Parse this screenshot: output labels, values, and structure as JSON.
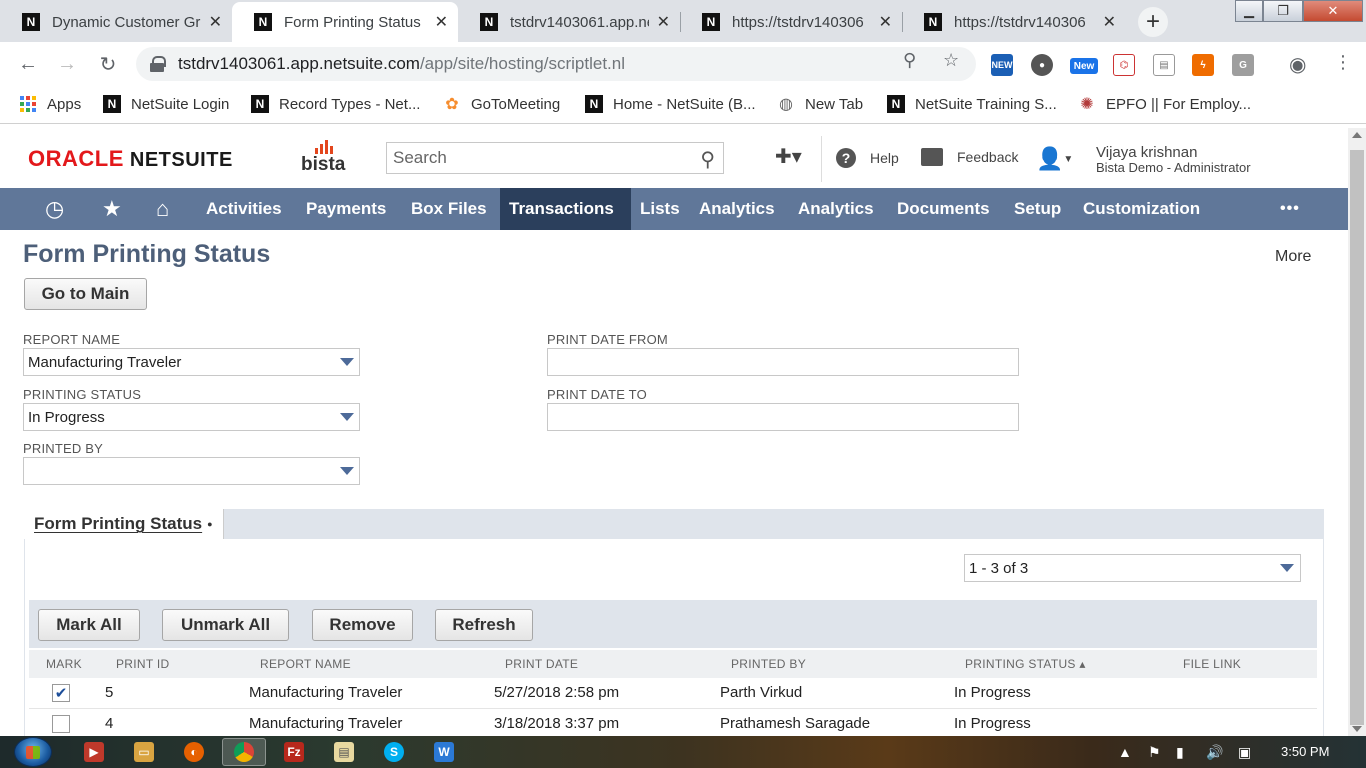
{
  "browser": {
    "tabs": [
      {
        "label": "Dynamic Customer Gr",
        "active": false
      },
      {
        "label": "Form Printing Status",
        "active": true
      },
      {
        "label": "tstdrv1403061.app.ne",
        "active": false
      },
      {
        "label": "https://tstdrv140306",
        "active": false
      },
      {
        "label": "https://tstdrv140306",
        "active": false
      }
    ],
    "url_host": "tstdrv1403061.app.netsuite.com",
    "url_path": "/app/site/hosting/scriptlet.nl",
    "bookmarks": [
      {
        "label": "Apps",
        "icon": "apps-grid-icon"
      },
      {
        "label": "NetSuite Login",
        "icon": "netsuite-icon"
      },
      {
        "label": "Record Types - Net...",
        "icon": "netsuite-icon"
      },
      {
        "label": "GoToMeeting",
        "icon": "gotomeeting-icon"
      },
      {
        "label": "Home - NetSuite (B...",
        "icon": "netsuite-icon"
      },
      {
        "label": "New Tab",
        "icon": "globe-icon"
      },
      {
        "label": "NetSuite Training S...",
        "icon": "netsuite-icon"
      },
      {
        "label": "EPFO || For Employ...",
        "icon": "epfo-icon"
      }
    ],
    "extension_badge_new": "New",
    "extension_new_label": "NEW"
  },
  "netsuite": {
    "logo_oracle": "ORACLE",
    "logo_netsuite": "NETSUITE",
    "logo_bista": "bista",
    "search_placeholder": "Search",
    "help_label": "Help",
    "feedback_label": "Feedback",
    "user_name": "Vijaya krishnan",
    "user_role": "Bista Demo - Administrator",
    "nav_items": [
      {
        "label": "Activities",
        "active": false
      },
      {
        "label": "Payments",
        "active": false
      },
      {
        "label": "Box Files",
        "active": false
      },
      {
        "label": "Transactions",
        "active": true
      },
      {
        "label": "Lists",
        "active": false
      },
      {
        "label": "Analytics",
        "active": false
      },
      {
        "label": "Analytics",
        "active": false
      },
      {
        "label": "Documents",
        "active": false
      },
      {
        "label": "Setup",
        "active": false
      },
      {
        "label": "Customization",
        "active": false
      }
    ],
    "nav_more": "•••"
  },
  "page": {
    "title": "Form Printing Status",
    "more_label": "More",
    "go_to_main": "Go to Main",
    "filters": {
      "report_name_label": "REPORT NAME",
      "report_name_value": "Manufacturing Traveler",
      "printing_status_label": "PRINTING STATUS",
      "printing_status_value": "In Progress",
      "printed_by_label": "PRINTED BY",
      "printed_by_value": "",
      "print_date_from_label": "PRINT DATE FROM",
      "print_date_from_value": "",
      "print_date_to_label": "PRINT DATE TO",
      "print_date_to_value": ""
    },
    "sublist": {
      "tab_label": "Form Printing Status",
      "tab_dot": "●",
      "pager": "1 - 3 of 3",
      "buttons": {
        "mark_all": "Mark All",
        "unmark_all": "Unmark All",
        "remove": "Remove",
        "refresh": "Refresh"
      },
      "columns": {
        "mark": "MARK",
        "print_id": "PRINT ID",
        "report_name": "REPORT NAME",
        "print_date": "PRINT DATE",
        "printed_by": "PRINTED BY",
        "printing_status": "PRINTING STATUS ▴",
        "file_link": "FILE LINK"
      },
      "rows": [
        {
          "marked": true,
          "print_id": "5",
          "report_name": "Manufacturing Traveler",
          "print_date": "5/27/2018 2:58 pm",
          "printed_by": "Parth Virkud",
          "printing_status": "In Progress",
          "file_link": ""
        },
        {
          "marked": false,
          "print_id": "4",
          "report_name": "Manufacturing Traveler",
          "print_date": "3/18/2018 3:37 pm",
          "printed_by": "Prathamesh Saragade",
          "printing_status": "In Progress",
          "file_link": ""
        }
      ]
    }
  },
  "taskbar": {
    "clock": "3:50 PM"
  },
  "colors": {
    "nav_bg": "#607799",
    "nav_active": "#2b3f5c",
    "title": "#4d5f79",
    "oracle_red": "#e3181b"
  }
}
